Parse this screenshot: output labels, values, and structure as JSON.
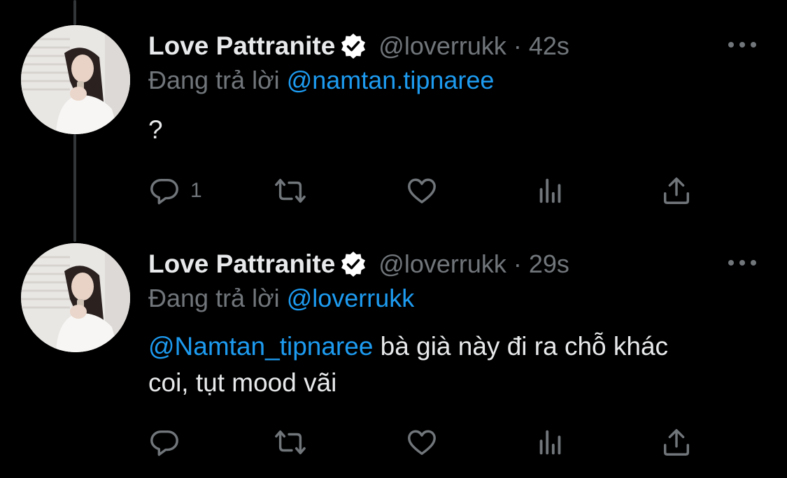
{
  "colors": {
    "background": "#000000",
    "text": "#e7e9ea",
    "secondary": "#71767b",
    "accent": "#1d9bf0",
    "thread_line": "#333639"
  },
  "tweets": [
    {
      "author_name": "Love Pattranite",
      "verified_icon": "verified-badge-icon",
      "handle": "@loverrukk",
      "separator": "·",
      "time": "42s",
      "reply_prefix": "Đang trả lời",
      "reply_mention": "@namtan.tipnaree",
      "body_mention": "",
      "body_text": "?",
      "reply_count": "1",
      "icons": [
        "reply-icon",
        "retweet-icon",
        "like-icon",
        "analytics-icon",
        "share-icon"
      ]
    },
    {
      "author_name": "Love Pattranite",
      "verified_icon": "verified-badge-icon",
      "handle": "@loverrukk",
      "separator": "·",
      "time": "29s",
      "reply_prefix": "Đang trả lời",
      "reply_mention": "@loverrukk",
      "body_mention": "@Namtan_tipnaree",
      "body_text": " bà già này đi ra chỗ khác coi, tụt mood vãi",
      "reply_count": "",
      "icons": [
        "reply-icon",
        "retweet-icon",
        "like-icon",
        "analytics-icon",
        "share-icon"
      ]
    }
  ]
}
